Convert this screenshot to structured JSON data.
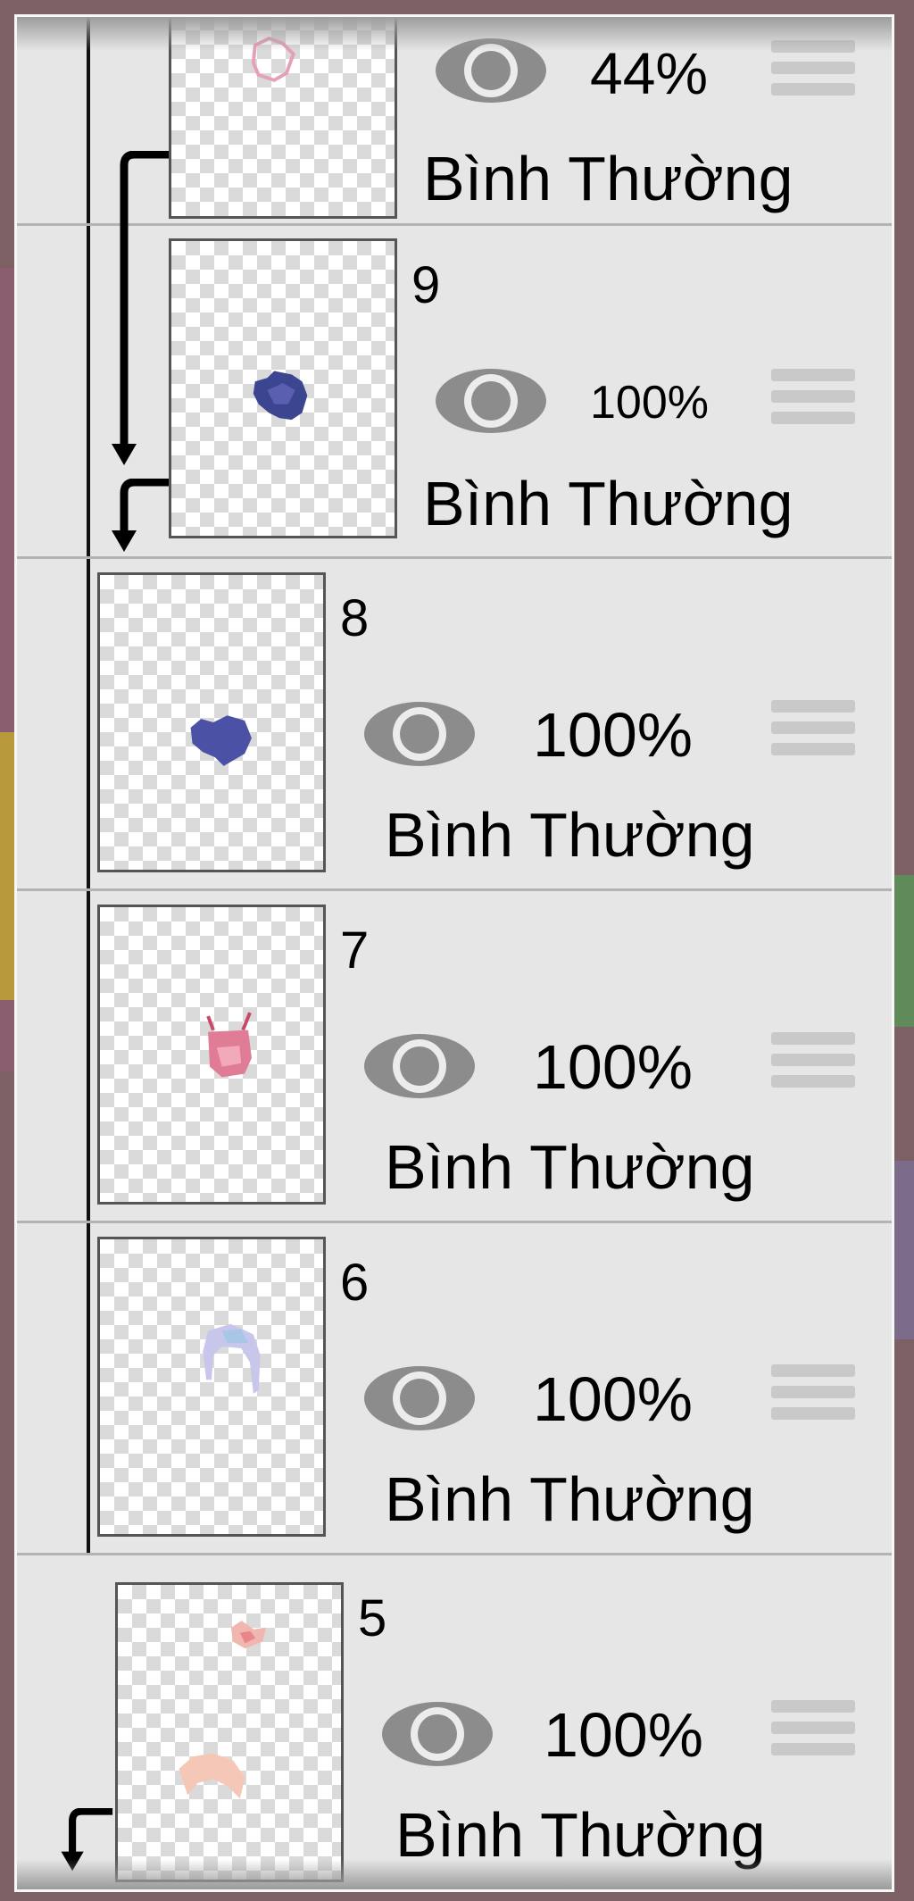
{
  "colors": {
    "panel_background": "#e6e6e6",
    "divider": "#b3b3b3",
    "eye_icon": "#8c8c8c",
    "handle": "#c9c9c9"
  },
  "layers": [
    {
      "number": "",
      "opacity": "44%",
      "blend_mode": "Bình Thường"
    },
    {
      "number": "9",
      "opacity": "100%",
      "blend_mode": "Bình Thường"
    },
    {
      "number": "8",
      "opacity": "100%",
      "blend_mode": "Bình Thường"
    },
    {
      "number": "7",
      "opacity": "100%",
      "blend_mode": "Bình Thường"
    },
    {
      "number": "6",
      "opacity": "100%",
      "blend_mode": "Bình Thường"
    },
    {
      "number": "5",
      "opacity": "100%",
      "blend_mode": "Bình Thường"
    }
  ],
  "icons": {
    "visibility": "eye-icon",
    "reorder": "drag-handle-icon",
    "clipping": "clipping-arrow-icon"
  }
}
